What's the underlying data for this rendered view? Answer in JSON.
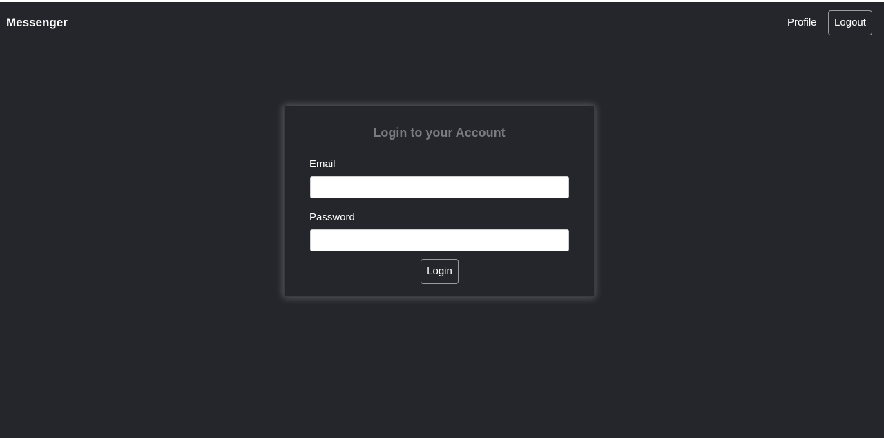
{
  "navbar": {
    "brand": "Messenger",
    "profile_link": "Profile",
    "logout_label": "Logout"
  },
  "login_card": {
    "title": "Login to your Account",
    "email": {
      "label": "Email",
      "value": "",
      "placeholder": ""
    },
    "password": {
      "label": "Password",
      "value": "",
      "placeholder": ""
    },
    "submit_label": "Login"
  },
  "colors": {
    "background": "#25262b",
    "title_text": "#7a7b80",
    "button_border": "#9a9ba0"
  }
}
